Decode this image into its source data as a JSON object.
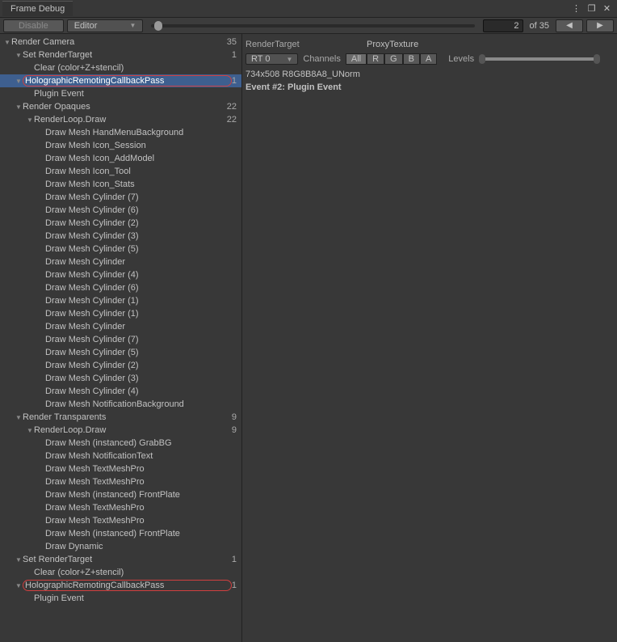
{
  "window_title": "Frame Debug",
  "toolbar": {
    "disable": "Disable",
    "editor": "Editor",
    "event_current": "2",
    "event_total": "of 35"
  },
  "details": {
    "render_target_label": "RenderTarget",
    "render_target_value": "ProxyTexture",
    "rt_dd": "RT 0",
    "channels_label": "Channels",
    "channels": {
      "all": "All",
      "r": "R",
      "g": "G",
      "b": "B",
      "a": "A"
    },
    "levels_label": "Levels",
    "info_format": "734x508 R8G8B8A8_UNorm",
    "info_event": "Event #2: Plugin Event"
  },
  "tree": [
    {
      "indent": 0,
      "arrow": "down",
      "label": "Render Camera",
      "count": "35"
    },
    {
      "indent": 1,
      "arrow": "down",
      "label": "Set RenderTarget",
      "count": "1"
    },
    {
      "indent": 2,
      "arrow": "none",
      "label": "Clear (color+Z+stencil)"
    },
    {
      "indent": 1,
      "arrow": "down",
      "label": "HolographicRemotingCallbackPass",
      "count": "1",
      "selected": true,
      "circled": true
    },
    {
      "indent": 2,
      "arrow": "none",
      "label": "Plugin Event"
    },
    {
      "indent": 1,
      "arrow": "down",
      "label": "Render Opaques",
      "count": "22"
    },
    {
      "indent": 2,
      "arrow": "down",
      "label": "RenderLoop.Draw",
      "count": "22"
    },
    {
      "indent": 3,
      "arrow": "none",
      "label": "Draw Mesh HandMenuBackground"
    },
    {
      "indent": 3,
      "arrow": "none",
      "label": "Draw Mesh Icon_Session"
    },
    {
      "indent": 3,
      "arrow": "none",
      "label": "Draw Mesh Icon_AddModel"
    },
    {
      "indent": 3,
      "arrow": "none",
      "label": "Draw Mesh Icon_Tool"
    },
    {
      "indent": 3,
      "arrow": "none",
      "label": "Draw Mesh Icon_Stats"
    },
    {
      "indent": 3,
      "arrow": "none",
      "label": "Draw Mesh Cylinder (7)"
    },
    {
      "indent": 3,
      "arrow": "none",
      "label": "Draw Mesh Cylinder (6)"
    },
    {
      "indent": 3,
      "arrow": "none",
      "label": "Draw Mesh Cylinder (2)"
    },
    {
      "indent": 3,
      "arrow": "none",
      "label": "Draw Mesh Cylinder (3)"
    },
    {
      "indent": 3,
      "arrow": "none",
      "label": "Draw Mesh Cylinder (5)"
    },
    {
      "indent": 3,
      "arrow": "none",
      "label": "Draw Mesh Cylinder"
    },
    {
      "indent": 3,
      "arrow": "none",
      "label": "Draw Mesh Cylinder (4)"
    },
    {
      "indent": 3,
      "arrow": "none",
      "label": "Draw Mesh Cylinder (6)"
    },
    {
      "indent": 3,
      "arrow": "none",
      "label": "Draw Mesh Cylinder (1)"
    },
    {
      "indent": 3,
      "arrow": "none",
      "label": "Draw Mesh Cylinder (1)"
    },
    {
      "indent": 3,
      "arrow": "none",
      "label": "Draw Mesh Cylinder"
    },
    {
      "indent": 3,
      "arrow": "none",
      "label": "Draw Mesh Cylinder (7)"
    },
    {
      "indent": 3,
      "arrow": "none",
      "label": "Draw Mesh Cylinder (5)"
    },
    {
      "indent": 3,
      "arrow": "none",
      "label": "Draw Mesh Cylinder (2)"
    },
    {
      "indent": 3,
      "arrow": "none",
      "label": "Draw Mesh Cylinder (3)"
    },
    {
      "indent": 3,
      "arrow": "none",
      "label": "Draw Mesh Cylinder (4)"
    },
    {
      "indent": 3,
      "arrow": "none",
      "label": "Draw Mesh NotificationBackground"
    },
    {
      "indent": 1,
      "arrow": "down",
      "label": "Render Transparents",
      "count": "9"
    },
    {
      "indent": 2,
      "arrow": "down",
      "label": "RenderLoop.Draw",
      "count": "9"
    },
    {
      "indent": 3,
      "arrow": "none",
      "label": "Draw Mesh (instanced) GrabBG"
    },
    {
      "indent": 3,
      "arrow": "none",
      "label": "Draw Mesh NotificationText"
    },
    {
      "indent": 3,
      "arrow": "none",
      "label": "Draw Mesh TextMeshPro"
    },
    {
      "indent": 3,
      "arrow": "none",
      "label": "Draw Mesh TextMeshPro"
    },
    {
      "indent": 3,
      "arrow": "none",
      "label": "Draw Mesh (instanced) FrontPlate"
    },
    {
      "indent": 3,
      "arrow": "none",
      "label": "Draw Mesh TextMeshPro"
    },
    {
      "indent": 3,
      "arrow": "none",
      "label": "Draw Mesh TextMeshPro"
    },
    {
      "indent": 3,
      "arrow": "none",
      "label": "Draw Mesh (instanced) FrontPlate"
    },
    {
      "indent": 3,
      "arrow": "none",
      "label": "Draw Dynamic"
    },
    {
      "indent": 1,
      "arrow": "down",
      "label": "Set RenderTarget",
      "count": "1"
    },
    {
      "indent": 2,
      "arrow": "none",
      "label": "Clear (color+Z+stencil)"
    },
    {
      "indent": 1,
      "arrow": "down",
      "label": "HolographicRemotingCallbackPass",
      "count": "1",
      "circled": true
    },
    {
      "indent": 2,
      "arrow": "none",
      "label": "Plugin Event"
    }
  ]
}
